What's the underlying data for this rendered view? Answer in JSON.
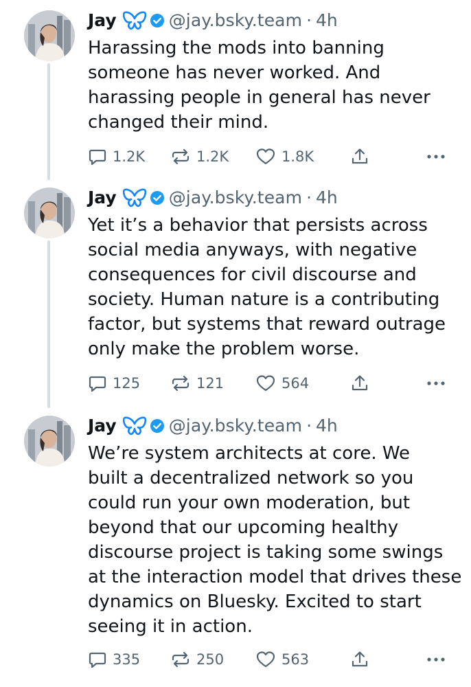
{
  "posts": [
    {
      "author": {
        "name": "Jay",
        "handle": "@jay.bsky.team"
      },
      "separator": "·",
      "time": "4h",
      "text": "Harassing the mods into banning\nsomeone has never worked. And\nharassing people in general has never\nchanged their mind.",
      "counts": {
        "replies": "1.2K",
        "reposts": "1.2K",
        "likes": "1.8K"
      }
    },
    {
      "author": {
        "name": "Jay",
        "handle": "@jay.bsky.team"
      },
      "separator": "·",
      "time": "4h",
      "text": "Yet it’s a behavior that persists across\nsocial media anyways, with negative\nconsequences for civil discourse and\nsociety. Human nature is a contributing\nfactor, but systems that reward outrage\nonly make the problem worse.",
      "counts": {
        "replies": "125",
        "reposts": "121",
        "likes": "564"
      }
    },
    {
      "author": {
        "name": "Jay",
        "handle": "@jay.bsky.team"
      },
      "separator": "·",
      "time": "4h",
      "text": "We’re system architects at core. We\nbuilt a decentralized network so you\ncould run your own moderation, but\nbeyond that our upcoming healthy\ndiscourse project is taking some swings\nat the interaction model that drives these\ndynamics on Bluesky. Excited to start\nseeing it in action.",
      "counts": {
        "replies": "335",
        "reposts": "250",
        "likes": "563"
      }
    }
  ],
  "icons": {
    "butterfly": "butterfly-icon",
    "verified": "verified-badge-icon",
    "reply": "reply-icon",
    "repost": "repost-icon",
    "like": "heart-icon",
    "share": "share-icon",
    "more": "more-options-icon"
  },
  "colors": {
    "text": "#0f1419",
    "secondary": "#536471",
    "butterfly": "#1185fe",
    "verified": "#1d9bf0",
    "thread_line": "#d7dde3"
  }
}
